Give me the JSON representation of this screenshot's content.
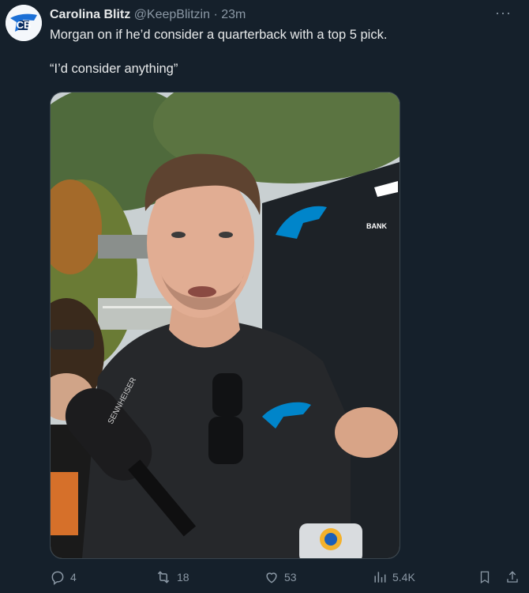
{
  "tweet": {
    "display_name": "Carolina Blitz",
    "handle": "@KeepBlitzin",
    "separator": "·",
    "time": "23m",
    "text_line1": "Morgan on if he’d consider a quarterback with a top 5 pick.",
    "text_line2": "“I’d consider anything”",
    "more_label": "···",
    "avatar_icon": "carolina-blitz-logo"
  },
  "media": {
    "logo_text": "BANK",
    "mic_brand": "SENNHEISER"
  },
  "actions": {
    "replies": "4",
    "retweets": "18",
    "likes": "53",
    "views": "5.4K"
  },
  "colors": {
    "background": "#15202b",
    "text": "#e7e9ea",
    "muted": "#8b98a5",
    "panthers_blue": "#0085ca"
  }
}
